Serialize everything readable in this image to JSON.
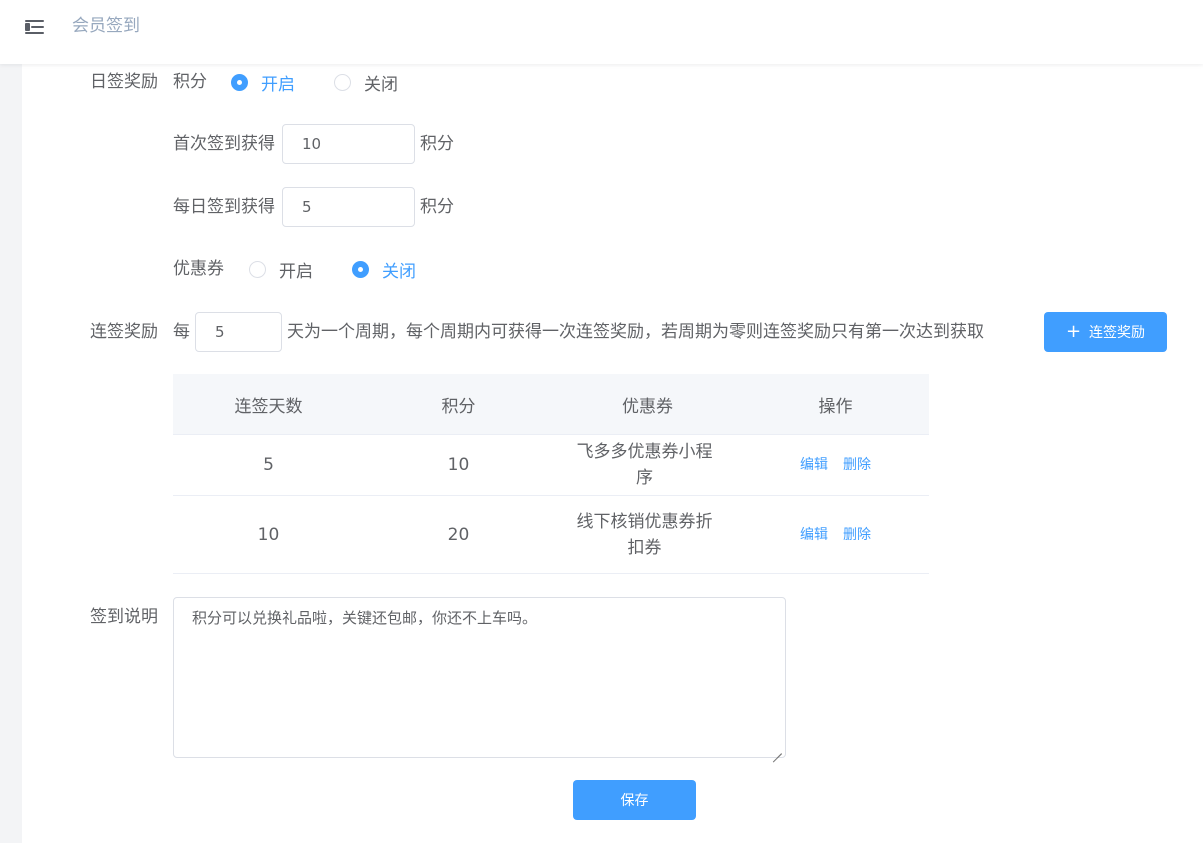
{
  "header": {
    "title": "会员签到"
  },
  "daily": {
    "label": "日签奖励",
    "points_label": "积分",
    "points_on": "开启",
    "points_off": "关闭",
    "points_enabled": true,
    "first_label": "首次签到获得",
    "first_value": "10",
    "first_unit": "积分",
    "daily_label": "每日签到获得",
    "daily_value": "5",
    "daily_unit": "积分",
    "coupon_label": "优惠券",
    "coupon_on": "开启",
    "coupon_off": "关闭",
    "coupon_enabled": false
  },
  "streak": {
    "label": "连签奖励",
    "prefix": "每",
    "days_value": "5",
    "suffix": "天为一个周期，每个周期内可获得一次连签奖励，若周期为零则连签奖励只有第一次达到获取",
    "add_button": "连签奖励",
    "add_icon": "plus-icon"
  },
  "table": {
    "columns": [
      "连签天数",
      "积分",
      "优惠券",
      "操作"
    ],
    "rows": [
      {
        "days": "5",
        "points": "10",
        "coupon": "飞多多优惠券小程序",
        "edit": "编辑",
        "delete": "删除"
      },
      {
        "days": "10",
        "points": "20",
        "coupon": "线下核销优惠券折扣券",
        "edit": "编辑",
        "delete": "删除"
      }
    ]
  },
  "description": {
    "label": "签到说明",
    "value": "积分可以兑换礼品啦，关键还包邮，你还不上车吗。"
  },
  "save_button": "保存",
  "colors": {
    "primary": "#409eff",
    "text": "#606266",
    "border": "#dcdfe6"
  }
}
